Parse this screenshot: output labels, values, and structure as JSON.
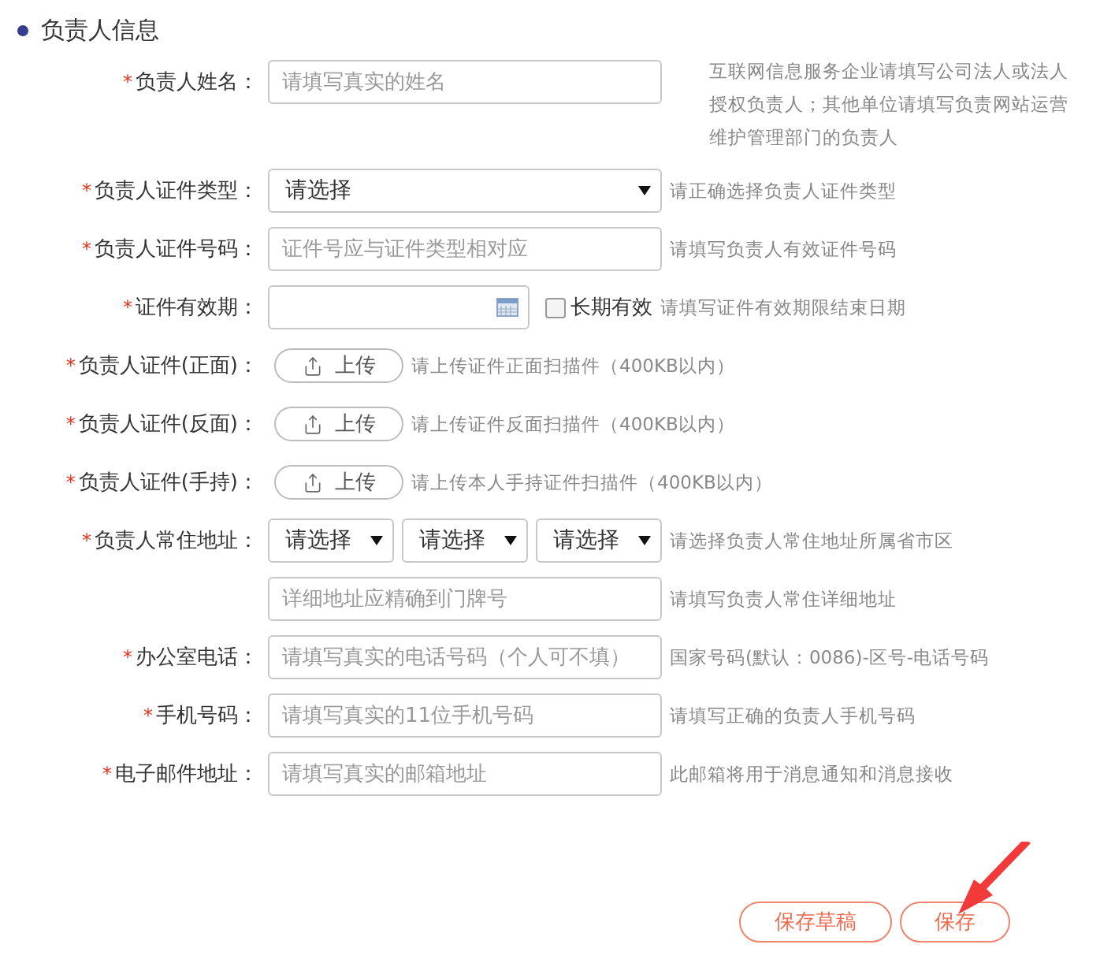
{
  "section_title": "负责人信息",
  "rows": [
    {
      "kind": "text",
      "label": "负责人姓名：",
      "star": "*",
      "placeholder": "请填写真实的姓名",
      "hint": "互联网信息服务企业请填写公司法人或法人授权负责人；其他单位请填写负责网站运营维护管理部门的负责人"
    },
    {
      "kind": "select",
      "label": "负责人证件类型：",
      "star": "*",
      "value": "请选择",
      "hint": "请正确选择负责人证件类型"
    },
    {
      "kind": "text",
      "label": "负责人证件号码：",
      "star": "*",
      "placeholder": "证件号应与证件类型相对应",
      "hint": "请填写负责人有效证件号码"
    },
    {
      "kind": "date",
      "label": "证件有效期：",
      "star": "*",
      "checkbox": {
        "label": "长期有效",
        "checked": false
      },
      "hint": "请填写证件有效期限结束日期"
    },
    {
      "kind": "upload",
      "label": "负责人证件(正面)：",
      "star": "*",
      "button": "上传",
      "hint": "请上传证件正面扫描件（400KB以内）"
    },
    {
      "kind": "upload",
      "label": "负责人证件(反面)：",
      "star": "*",
      "button": "上传",
      "hint": "请上传证件反面扫描件（400KB以内）"
    },
    {
      "kind": "upload",
      "label": "负责人证件(手持)：",
      "star": "*",
      "button": "上传",
      "hint": "请上传本人手持证件扫描件（400KB以内）"
    },
    {
      "kind": "address",
      "label": "负责人常住地址：",
      "star": "*",
      "selects": [
        "请选择",
        "请选择",
        "请选择"
      ],
      "hint": "请选择负责人常住地址所属省市区"
    },
    {
      "kind": "text",
      "placeholder": "详细地址应精确到门牌号",
      "hint": "请填写负责人常住详细地址"
    },
    {
      "kind": "text",
      "label": "办公室电话：",
      "star": "*",
      "placeholder": "请填写真实的电话号码（个人可不填）",
      "hint": "国家号码(默认：0086)-区号-电话号码"
    },
    {
      "kind": "text",
      "label": "手机号码：",
      "star": "*",
      "placeholder": "请填写真实的11位手机号码",
      "hint": "请填写正确的负责人手机号码"
    },
    {
      "kind": "text",
      "label": "电子邮件地址：",
      "star": "*",
      "placeholder": "请填写真实的邮箱地址",
      "hint": "此邮箱将用于消息通知和消息接收"
    }
  ],
  "buttons": [
    "保存草稿",
    "保存"
  ]
}
